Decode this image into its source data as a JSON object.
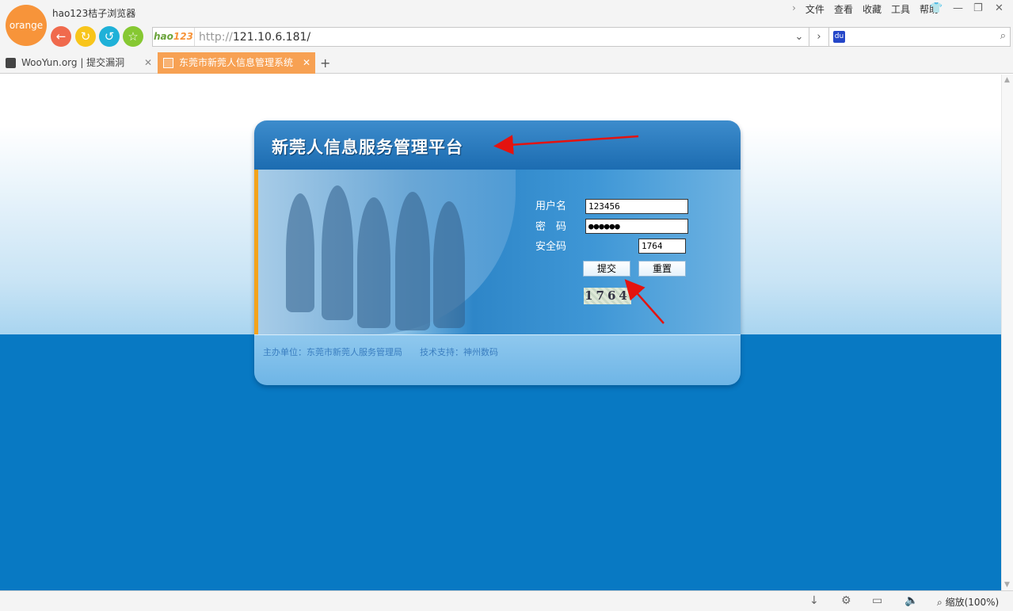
{
  "browser": {
    "logo_text": "orange",
    "app_title": "hao123桔子浏览器",
    "menu": [
      "文件",
      "查看",
      "收藏",
      "工具",
      "帮助"
    ],
    "url_protocol": "http://",
    "url_host": "121.10.6.181/",
    "hao_logo": "hao",
    "hao_logo_num": "123",
    "search_value": "",
    "zoom_label": "缩放(100%)",
    "accent_color": "#f7a153"
  },
  "tabs": [
    {
      "title": "WooYun.org | 提交漏洞",
      "active": false
    },
    {
      "title": "东莞市新莞人信息管理系统",
      "active": true
    }
  ],
  "login": {
    "title": "新莞人信息服务管理平台",
    "username_label": "用户名",
    "username_value": "123456",
    "password_label": "密　码",
    "password_value": "●●●●●●",
    "captcha_label": "安全码",
    "captcha_image_text": "1764",
    "captcha_value": "1764",
    "submit_label": "提交",
    "reset_label": "重置",
    "footer": "主办单位：东莞市新莞人服务管理局　　技术支持：神州数码"
  }
}
